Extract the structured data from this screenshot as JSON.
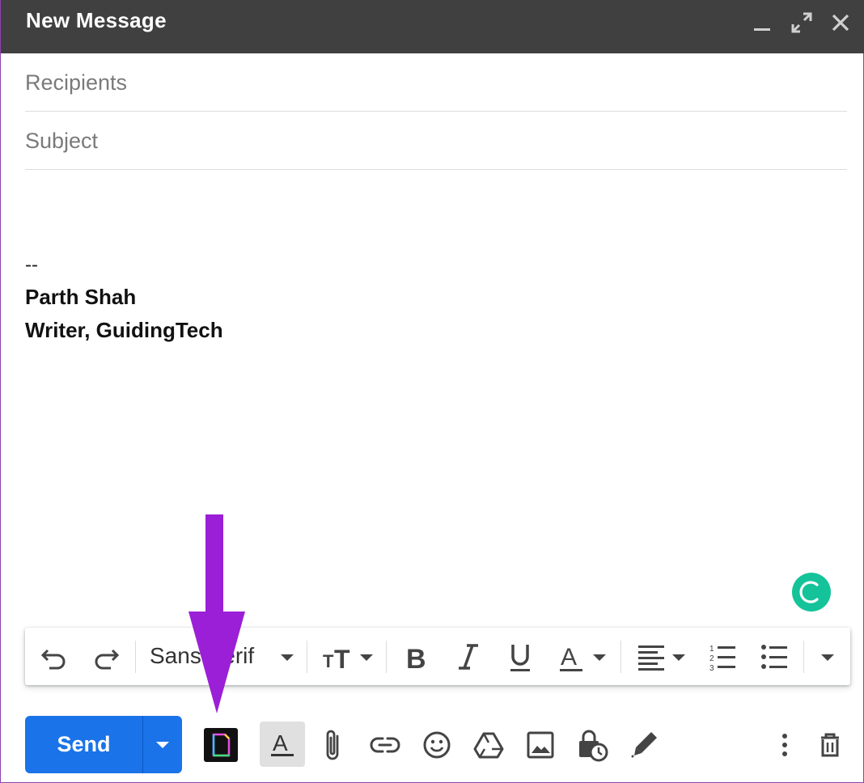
{
  "window": {
    "title": "New Message",
    "controls": [
      "minimize-icon",
      "fullscreen-icon",
      "close-icon"
    ]
  },
  "fields": {
    "recipients_placeholder": "Recipients",
    "subject_placeholder": "Subject"
  },
  "body": {
    "signature_separator": "--",
    "signature_name": "Parth Shah",
    "signature_title": "Writer, GuidingTech"
  },
  "formatting_toolbar": {
    "font_family": "Sans Serif",
    "items": [
      "undo-icon",
      "redo-icon",
      "font-family-select",
      "font-size-icon",
      "bold-icon",
      "italic-icon",
      "underline-icon",
      "text-color-icon",
      "align-icon",
      "numbered-list-icon",
      "bulleted-list-icon",
      "more-formatting-icon"
    ]
  },
  "bottom_toolbar": {
    "send_label": "Send",
    "icons": [
      "confidential-doc-icon",
      "formatting-options-icon",
      "attach-file-icon",
      "insert-link-icon",
      "insert-emoji-icon",
      "google-drive-icon",
      "insert-photo-icon",
      "confidential-mode-icon",
      "insert-signature-icon",
      "more-options-icon",
      "discard-draft-icon"
    ]
  },
  "colors": {
    "titlebar": "#404040",
    "send_button": "#1a73e8",
    "grammarly": "#15c39a",
    "annotation_arrow": "#9b1fd6"
  }
}
